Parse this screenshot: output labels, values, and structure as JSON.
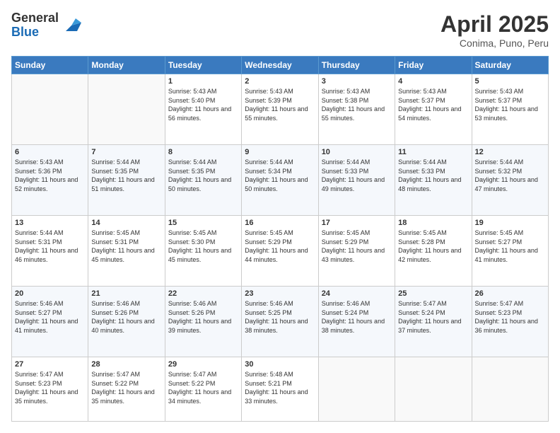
{
  "logo": {
    "general": "General",
    "blue": "Blue"
  },
  "header": {
    "title": "April 2025",
    "subtitle": "Conima, Puno, Peru"
  },
  "days": [
    "Sunday",
    "Monday",
    "Tuesday",
    "Wednesday",
    "Thursday",
    "Friday",
    "Saturday"
  ],
  "weeks": [
    [
      {
        "day": "",
        "info": ""
      },
      {
        "day": "",
        "info": ""
      },
      {
        "day": "1",
        "info": "Sunrise: 5:43 AM\nSunset: 5:40 PM\nDaylight: 11 hours and 56 minutes."
      },
      {
        "day": "2",
        "info": "Sunrise: 5:43 AM\nSunset: 5:39 PM\nDaylight: 11 hours and 55 minutes."
      },
      {
        "day": "3",
        "info": "Sunrise: 5:43 AM\nSunset: 5:38 PM\nDaylight: 11 hours and 55 minutes."
      },
      {
        "day": "4",
        "info": "Sunrise: 5:43 AM\nSunset: 5:37 PM\nDaylight: 11 hours and 54 minutes."
      },
      {
        "day": "5",
        "info": "Sunrise: 5:43 AM\nSunset: 5:37 PM\nDaylight: 11 hours and 53 minutes."
      }
    ],
    [
      {
        "day": "6",
        "info": "Sunrise: 5:43 AM\nSunset: 5:36 PM\nDaylight: 11 hours and 52 minutes."
      },
      {
        "day": "7",
        "info": "Sunrise: 5:44 AM\nSunset: 5:35 PM\nDaylight: 11 hours and 51 minutes."
      },
      {
        "day": "8",
        "info": "Sunrise: 5:44 AM\nSunset: 5:35 PM\nDaylight: 11 hours and 50 minutes."
      },
      {
        "day": "9",
        "info": "Sunrise: 5:44 AM\nSunset: 5:34 PM\nDaylight: 11 hours and 50 minutes."
      },
      {
        "day": "10",
        "info": "Sunrise: 5:44 AM\nSunset: 5:33 PM\nDaylight: 11 hours and 49 minutes."
      },
      {
        "day": "11",
        "info": "Sunrise: 5:44 AM\nSunset: 5:33 PM\nDaylight: 11 hours and 48 minutes."
      },
      {
        "day": "12",
        "info": "Sunrise: 5:44 AM\nSunset: 5:32 PM\nDaylight: 11 hours and 47 minutes."
      }
    ],
    [
      {
        "day": "13",
        "info": "Sunrise: 5:44 AM\nSunset: 5:31 PM\nDaylight: 11 hours and 46 minutes."
      },
      {
        "day": "14",
        "info": "Sunrise: 5:45 AM\nSunset: 5:31 PM\nDaylight: 11 hours and 45 minutes."
      },
      {
        "day": "15",
        "info": "Sunrise: 5:45 AM\nSunset: 5:30 PM\nDaylight: 11 hours and 45 minutes."
      },
      {
        "day": "16",
        "info": "Sunrise: 5:45 AM\nSunset: 5:29 PM\nDaylight: 11 hours and 44 minutes."
      },
      {
        "day": "17",
        "info": "Sunrise: 5:45 AM\nSunset: 5:29 PM\nDaylight: 11 hours and 43 minutes."
      },
      {
        "day": "18",
        "info": "Sunrise: 5:45 AM\nSunset: 5:28 PM\nDaylight: 11 hours and 42 minutes."
      },
      {
        "day": "19",
        "info": "Sunrise: 5:45 AM\nSunset: 5:27 PM\nDaylight: 11 hours and 41 minutes."
      }
    ],
    [
      {
        "day": "20",
        "info": "Sunrise: 5:46 AM\nSunset: 5:27 PM\nDaylight: 11 hours and 41 minutes."
      },
      {
        "day": "21",
        "info": "Sunrise: 5:46 AM\nSunset: 5:26 PM\nDaylight: 11 hours and 40 minutes."
      },
      {
        "day": "22",
        "info": "Sunrise: 5:46 AM\nSunset: 5:26 PM\nDaylight: 11 hours and 39 minutes."
      },
      {
        "day": "23",
        "info": "Sunrise: 5:46 AM\nSunset: 5:25 PM\nDaylight: 11 hours and 38 minutes."
      },
      {
        "day": "24",
        "info": "Sunrise: 5:46 AM\nSunset: 5:24 PM\nDaylight: 11 hours and 38 minutes."
      },
      {
        "day": "25",
        "info": "Sunrise: 5:47 AM\nSunset: 5:24 PM\nDaylight: 11 hours and 37 minutes."
      },
      {
        "day": "26",
        "info": "Sunrise: 5:47 AM\nSunset: 5:23 PM\nDaylight: 11 hours and 36 minutes."
      }
    ],
    [
      {
        "day": "27",
        "info": "Sunrise: 5:47 AM\nSunset: 5:23 PM\nDaylight: 11 hours and 35 minutes."
      },
      {
        "day": "28",
        "info": "Sunrise: 5:47 AM\nSunset: 5:22 PM\nDaylight: 11 hours and 35 minutes."
      },
      {
        "day": "29",
        "info": "Sunrise: 5:47 AM\nSunset: 5:22 PM\nDaylight: 11 hours and 34 minutes."
      },
      {
        "day": "30",
        "info": "Sunrise: 5:48 AM\nSunset: 5:21 PM\nDaylight: 11 hours and 33 minutes."
      },
      {
        "day": "",
        "info": ""
      },
      {
        "day": "",
        "info": ""
      },
      {
        "day": "",
        "info": ""
      }
    ]
  ]
}
